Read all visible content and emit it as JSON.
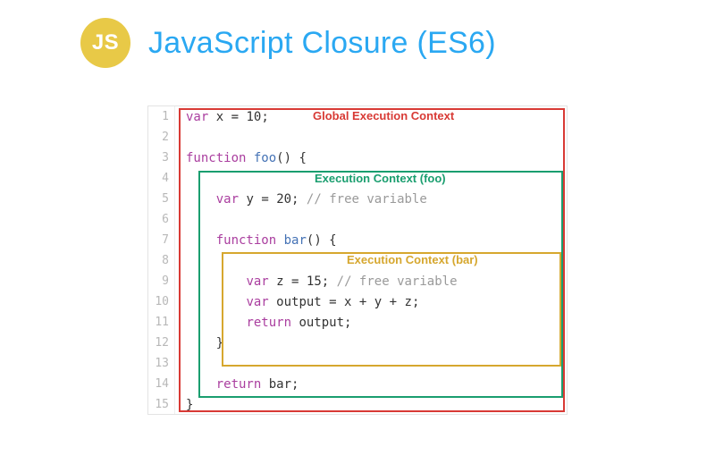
{
  "header": {
    "badge": "JS",
    "title": "JavaScript Closure (ES6)"
  },
  "boxes": {
    "global": "Global Execution Context",
    "foo": "Execution Context (foo)",
    "bar": "Execution Context (bar)"
  },
  "code": {
    "lines": [
      {
        "n": 1,
        "tokens": [
          [
            "kw",
            "var"
          ],
          [
            "id",
            " x "
          ],
          [
            "op",
            "="
          ],
          [
            "id",
            " "
          ],
          [
            "num",
            "10"
          ],
          [
            "punc",
            ";"
          ]
        ]
      },
      {
        "n": 2,
        "tokens": []
      },
      {
        "n": 3,
        "tokens": [
          [
            "kw",
            "function"
          ],
          [
            "id",
            " "
          ],
          [
            "func",
            "foo"
          ],
          [
            "punc",
            "() {"
          ]
        ]
      },
      {
        "n": 4,
        "tokens": []
      },
      {
        "n": 5,
        "tokens": [
          [
            "id",
            "    "
          ],
          [
            "kw",
            "var"
          ],
          [
            "id",
            " y "
          ],
          [
            "op",
            "="
          ],
          [
            "id",
            " "
          ],
          [
            "num",
            "20"
          ],
          [
            "punc",
            ";"
          ],
          [
            "id",
            " "
          ],
          [
            "cmt",
            "// free variable"
          ]
        ]
      },
      {
        "n": 6,
        "tokens": []
      },
      {
        "n": 7,
        "tokens": [
          [
            "id",
            "    "
          ],
          [
            "kw",
            "function"
          ],
          [
            "id",
            " "
          ],
          [
            "func",
            "bar"
          ],
          [
            "punc",
            "() {"
          ]
        ]
      },
      {
        "n": 8,
        "tokens": []
      },
      {
        "n": 9,
        "tokens": [
          [
            "id",
            "        "
          ],
          [
            "kw",
            "var"
          ],
          [
            "id",
            " z "
          ],
          [
            "op",
            "="
          ],
          [
            "id",
            " "
          ],
          [
            "num",
            "15"
          ],
          [
            "punc",
            ";"
          ],
          [
            "id",
            " "
          ],
          [
            "cmt",
            "// free variable"
          ]
        ]
      },
      {
        "n": 10,
        "tokens": [
          [
            "id",
            "        "
          ],
          [
            "kw",
            "var"
          ],
          [
            "id",
            " output "
          ],
          [
            "op",
            "="
          ],
          [
            "id",
            " x "
          ],
          [
            "op",
            "+"
          ],
          [
            "id",
            " y "
          ],
          [
            "op",
            "+"
          ],
          [
            "id",
            " z"
          ],
          [
            "punc",
            ";"
          ]
        ]
      },
      {
        "n": 11,
        "tokens": [
          [
            "id",
            "        "
          ],
          [
            "kw",
            "return"
          ],
          [
            "id",
            " output"
          ],
          [
            "punc",
            ";"
          ]
        ]
      },
      {
        "n": 12,
        "tokens": [
          [
            "id",
            "    "
          ],
          [
            "punc",
            "}"
          ]
        ]
      },
      {
        "n": 13,
        "tokens": []
      },
      {
        "n": 14,
        "tokens": [
          [
            "id",
            "    "
          ],
          [
            "kw",
            "return"
          ],
          [
            "id",
            " bar"
          ],
          [
            "punc",
            ";"
          ]
        ]
      },
      {
        "n": 15,
        "tokens": [
          [
            "punc",
            "}"
          ]
        ]
      }
    ]
  }
}
